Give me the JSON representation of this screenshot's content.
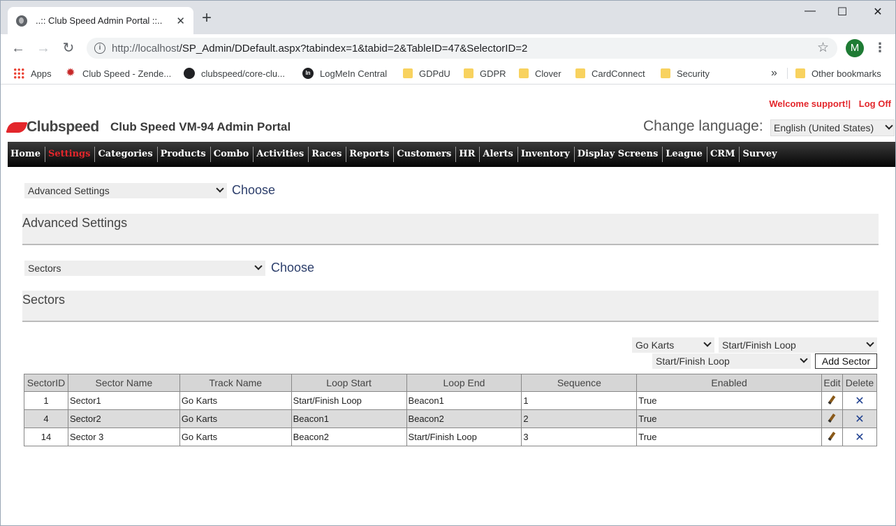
{
  "browser": {
    "tab_title": "..:: Club Speed Admin Portal ::..",
    "url_host": "http://localhost",
    "url_path": "/SP_Admin/DDefault.aspx?tabindex=1&tabid=2&TableID=47&SelectorID=2",
    "profile_initial": "M",
    "bookmarks": [
      {
        "label": "Apps",
        "icon": "apps-icon"
      },
      {
        "label": "Club Speed - Zende...",
        "icon": "gear-icon"
      },
      {
        "label": "clubspeed/core-clu...",
        "icon": "github-icon"
      },
      {
        "label": "LogMeIn Central",
        "icon": "logmein-icon"
      },
      {
        "label": "GDPdU",
        "icon": "folder-icon"
      },
      {
        "label": "GDPR",
        "icon": "folder-icon"
      },
      {
        "label": "Clover",
        "icon": "folder-icon"
      },
      {
        "label": "CardConnect",
        "icon": "folder-icon"
      },
      {
        "label": "Security",
        "icon": "folder-icon"
      }
    ],
    "overflow": "»",
    "other_bookmarks": "Other bookmarks"
  },
  "header": {
    "welcome": "Welcome support!|",
    "logoff": "Log Off",
    "brand": "Clubspeed",
    "portal_title": "Club Speed VM-94 Admin Portal",
    "change_language": "Change language:",
    "language": "English (United States)"
  },
  "menu": [
    "Home",
    "Settings",
    "Categories",
    "Products",
    "Combo",
    "Activities",
    "Races",
    "Reports",
    "Customers",
    "HR",
    "Alerts",
    "Inventory",
    "Display Screens",
    "League",
    "CRM",
    "Survey"
  ],
  "active_menu": "Settings",
  "selector1": {
    "value": "Advanced Settings",
    "choose": "Choose"
  },
  "section1": "Advanced Settings",
  "selector2": {
    "value": "Sectors",
    "choose": "Choose"
  },
  "section2": "Sectors",
  "filters": {
    "track": "Go Karts",
    "loop_start": "Start/Finish Loop",
    "loop_end": "Start/Finish Loop",
    "add_button": "Add Sector"
  },
  "table": {
    "headers": [
      "SectorID",
      "Sector Name",
      "Track Name",
      "Loop Start",
      "Loop End",
      "Sequence",
      "Enabled",
      "Edit",
      "Delete"
    ],
    "rows": [
      {
        "id": "1",
        "name": "Sector1",
        "track": "Go Karts",
        "start": "Start/Finish Loop",
        "end": "Beacon1",
        "seq": "1",
        "enabled": "True"
      },
      {
        "id": "4",
        "name": "Sector2",
        "track": "Go Karts",
        "start": "Beacon1",
        "end": "Beacon2",
        "seq": "2",
        "enabled": "True"
      },
      {
        "id": "14",
        "name": "Sector 3",
        "track": "Go Karts",
        "start": "Beacon2",
        "end": "Start/Finish Loop",
        "seq": "3",
        "enabled": "True"
      }
    ]
  }
}
